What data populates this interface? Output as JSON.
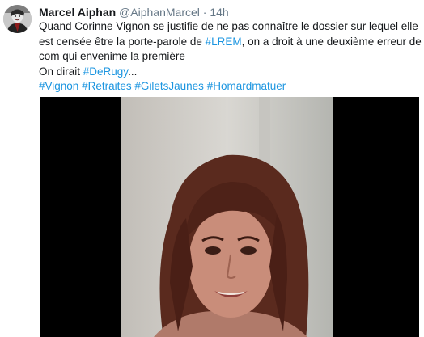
{
  "tweet": {
    "author_name": "Marcel Aiphan",
    "author_handle": "@AiphanMarcel",
    "separator": "·",
    "time": "14h",
    "avatar_icon": "avatar-portrait-icon",
    "lines": [
      [
        "Quand Corinne Vignon se justifie de ne pas connaître le dossier sur lequel elle"
      ],
      [
        "est censée être la porte-parole de ",
        "#LREM",
        ", on a droit à une deuxième erreur de"
      ],
      [
        "com qui envenime la première"
      ],
      [
        "On dirait ",
        "#DeRugy",
        "..."
      ],
      [
        "#Vignon",
        " ",
        "#Retraites",
        " ",
        "#GiletsJaunes",
        " ",
        "#Homardmatuer"
      ]
    ],
    "hashtag_color": "#1b95e0"
  },
  "media": {
    "type": "video",
    "icon": "video-thumbnail-woman-icon"
  }
}
